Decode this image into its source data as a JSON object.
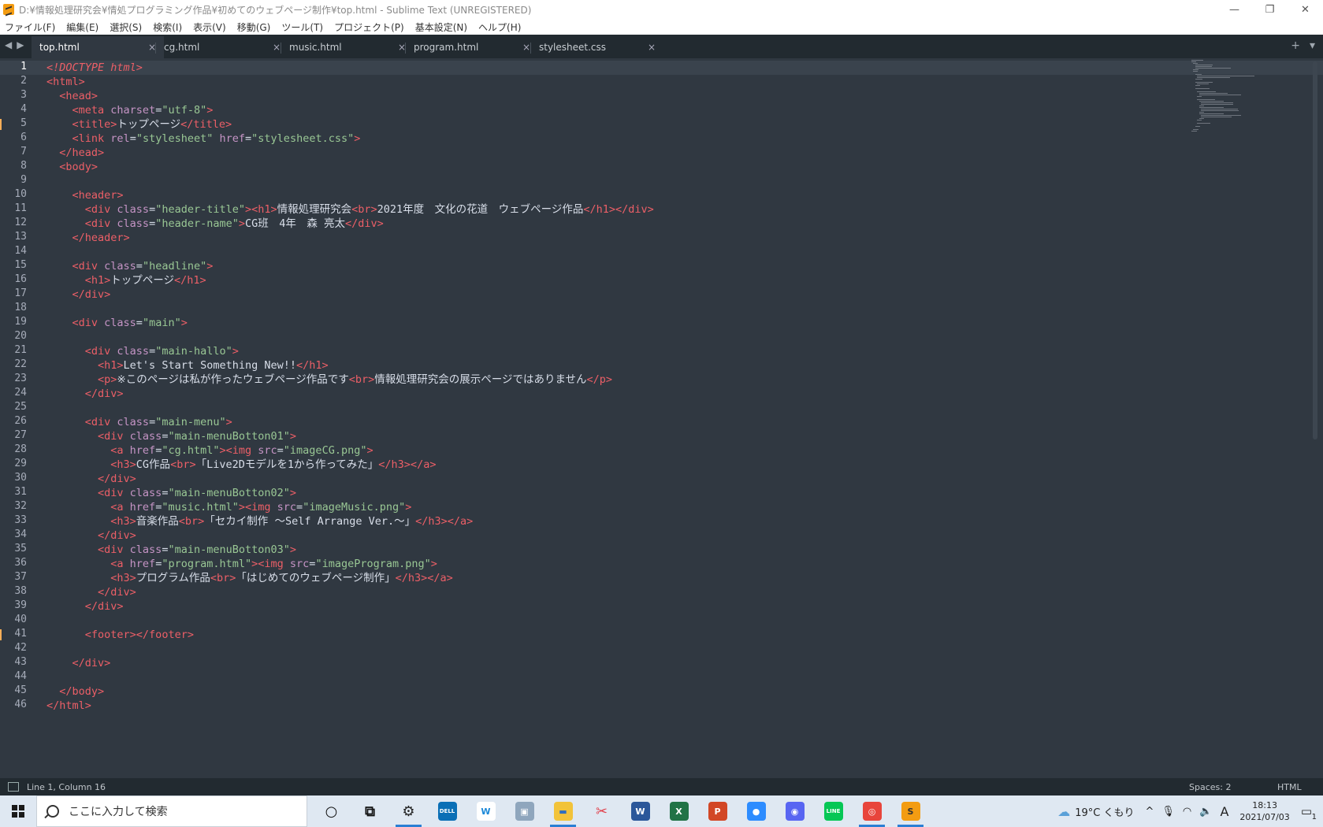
{
  "window": {
    "title": "D:¥情報処理研究会¥情処プログラミング作品¥初めてのウェブページ制作¥top.html - Sublime Text (UNREGISTERED)",
    "controls": {
      "minimize": "—",
      "restore": "❐",
      "close": "✕"
    }
  },
  "menu": {
    "items": [
      "ファイル(F)",
      "編集(E)",
      "選択(S)",
      "検索(I)",
      "表示(V)",
      "移動(G)",
      "ツール(T)",
      "プロジェクト(P)",
      "基本設定(N)",
      "ヘルプ(H)"
    ]
  },
  "tabs": [
    {
      "label": "top.html",
      "active": true
    },
    {
      "label": "cg.html",
      "active": false
    },
    {
      "label": "music.html",
      "active": false
    },
    {
      "label": "program.html",
      "active": false
    },
    {
      "label": "stylesheet.css",
      "active": false
    }
  ],
  "tab_close_glyph": "×",
  "tab_nav": {
    "back": "◀",
    "forward": "▶",
    "add": "+",
    "dropdown": "▾"
  },
  "editor": {
    "current_line": 1,
    "modified_lines": [
      5,
      41
    ],
    "lines": [
      [
        [
          "d",
          "<!DOCTYPE html"
        ],
        [
          "t",
          ">"
        ]
      ],
      [
        [
          "t",
          "<html>"
        ]
      ],
      [
        [
          "x",
          "  "
        ],
        [
          "t",
          "<head>"
        ]
      ],
      [
        [
          "x",
          "    "
        ],
        [
          "t",
          "<meta "
        ],
        [
          "a",
          "charset"
        ],
        [
          "x",
          "="
        ],
        [
          "s",
          "\"utf-8\""
        ],
        [
          "t",
          ">"
        ]
      ],
      [
        [
          "x",
          "    "
        ],
        [
          "t",
          "<title>"
        ],
        [
          "x",
          "トップページ"
        ],
        [
          "t",
          "</title>"
        ]
      ],
      [
        [
          "x",
          "    "
        ],
        [
          "t",
          "<link "
        ],
        [
          "a",
          "rel"
        ],
        [
          "x",
          "="
        ],
        [
          "s",
          "\"stylesheet\""
        ],
        [
          "x",
          " "
        ],
        [
          "a",
          "href"
        ],
        [
          "x",
          "="
        ],
        [
          "s",
          "\"stylesheet.css\""
        ],
        [
          "t",
          ">"
        ]
      ],
      [
        [
          "x",
          "  "
        ],
        [
          "t",
          "</head>"
        ]
      ],
      [
        [
          "x",
          "  "
        ],
        [
          "t",
          "<body>"
        ]
      ],
      [],
      [
        [
          "x",
          "    "
        ],
        [
          "t",
          "<header>"
        ]
      ],
      [
        [
          "x",
          "      "
        ],
        [
          "t",
          "<div "
        ],
        [
          "a",
          "class"
        ],
        [
          "x",
          "="
        ],
        [
          "s",
          "\"header-title\""
        ],
        [
          "t",
          "><h1>"
        ],
        [
          "x",
          "情報処理研究会"
        ],
        [
          "t",
          "<br>"
        ],
        [
          "x",
          "2021年度　文化の花道　ウェブページ作品"
        ],
        [
          "t",
          "</h1></div>"
        ]
      ],
      [
        [
          "x",
          "      "
        ],
        [
          "t",
          "<div "
        ],
        [
          "a",
          "class"
        ],
        [
          "x",
          "="
        ],
        [
          "s",
          "\"header-name\""
        ],
        [
          "t",
          ">"
        ],
        [
          "x",
          "CG班　4年　森 亮太"
        ],
        [
          "t",
          "</div>"
        ]
      ],
      [
        [
          "x",
          "    "
        ],
        [
          "t",
          "</header>"
        ]
      ],
      [],
      [
        [
          "x",
          "    "
        ],
        [
          "t",
          "<div "
        ],
        [
          "a",
          "class"
        ],
        [
          "x",
          "="
        ],
        [
          "s",
          "\"headline\""
        ],
        [
          "t",
          ">"
        ]
      ],
      [
        [
          "x",
          "      "
        ],
        [
          "t",
          "<h1>"
        ],
        [
          "x",
          "トップページ"
        ],
        [
          "t",
          "</h1>"
        ]
      ],
      [
        [
          "x",
          "    "
        ],
        [
          "t",
          "</div>"
        ]
      ],
      [],
      [
        [
          "x",
          "    "
        ],
        [
          "t",
          "<div "
        ],
        [
          "a",
          "class"
        ],
        [
          "x",
          "="
        ],
        [
          "s",
          "\"main\""
        ],
        [
          "t",
          ">"
        ]
      ],
      [],
      [
        [
          "x",
          "      "
        ],
        [
          "t",
          "<div "
        ],
        [
          "a",
          "class"
        ],
        [
          "x",
          "="
        ],
        [
          "s",
          "\"main-hallo\""
        ],
        [
          "t",
          ">"
        ]
      ],
      [
        [
          "x",
          "        "
        ],
        [
          "t",
          "<h1>"
        ],
        [
          "x",
          "Let's Start Something New!!"
        ],
        [
          "t",
          "</h1>"
        ]
      ],
      [
        [
          "x",
          "        "
        ],
        [
          "t",
          "<p>"
        ],
        [
          "x",
          "※このページは私が作ったウェブページ作品です"
        ],
        [
          "t",
          "<br>"
        ],
        [
          "x",
          "情報処理研究会の展示ページではありません"
        ],
        [
          "t",
          "</p>"
        ]
      ],
      [
        [
          "x",
          "      "
        ],
        [
          "t",
          "</div>"
        ]
      ],
      [],
      [
        [
          "x",
          "      "
        ],
        [
          "t",
          "<div "
        ],
        [
          "a",
          "class"
        ],
        [
          "x",
          "="
        ],
        [
          "s",
          "\"main-menu\""
        ],
        [
          "t",
          ">"
        ]
      ],
      [
        [
          "x",
          "        "
        ],
        [
          "t",
          "<div "
        ],
        [
          "a",
          "class"
        ],
        [
          "x",
          "="
        ],
        [
          "s",
          "\"main-menuBotton01\""
        ],
        [
          "t",
          ">"
        ]
      ],
      [
        [
          "x",
          "          "
        ],
        [
          "t",
          "<a "
        ],
        [
          "a",
          "href"
        ],
        [
          "x",
          "="
        ],
        [
          "s",
          "\"cg.html\""
        ],
        [
          "t",
          "><img "
        ],
        [
          "a",
          "src"
        ],
        [
          "x",
          "="
        ],
        [
          "s",
          "\"imageCG.png\""
        ],
        [
          "t",
          ">"
        ]
      ],
      [
        [
          "x",
          "          "
        ],
        [
          "t",
          "<h3>"
        ],
        [
          "x",
          "CG作品"
        ],
        [
          "t",
          "<br>"
        ],
        [
          "x",
          "「Live2Dモデルを1から作ってみた」"
        ],
        [
          "t",
          "</h3></a>"
        ]
      ],
      [
        [
          "x",
          "        "
        ],
        [
          "t",
          "</div>"
        ]
      ],
      [
        [
          "x",
          "        "
        ],
        [
          "t",
          "<div "
        ],
        [
          "a",
          "class"
        ],
        [
          "x",
          "="
        ],
        [
          "s",
          "\"main-menuBotton02\""
        ],
        [
          "t",
          ">"
        ]
      ],
      [
        [
          "x",
          "          "
        ],
        [
          "t",
          "<a "
        ],
        [
          "a",
          "href"
        ],
        [
          "x",
          "="
        ],
        [
          "s",
          "\"music.html\""
        ],
        [
          "t",
          "><img "
        ],
        [
          "a",
          "src"
        ],
        [
          "x",
          "="
        ],
        [
          "s",
          "\"imageMusic.png\""
        ],
        [
          "t",
          ">"
        ]
      ],
      [
        [
          "x",
          "          "
        ],
        [
          "t",
          "<h3>"
        ],
        [
          "x",
          "音楽作品"
        ],
        [
          "t",
          "<br>"
        ],
        [
          "x",
          "「セカイ制作 ～Self Arrange Ver.～」"
        ],
        [
          "t",
          "</h3></a>"
        ]
      ],
      [
        [
          "x",
          "        "
        ],
        [
          "t",
          "</div>"
        ]
      ],
      [
        [
          "x",
          "        "
        ],
        [
          "t",
          "<div "
        ],
        [
          "a",
          "class"
        ],
        [
          "x",
          "="
        ],
        [
          "s",
          "\"main-menuBotton03\""
        ],
        [
          "t",
          ">"
        ]
      ],
      [
        [
          "x",
          "          "
        ],
        [
          "t",
          "<a "
        ],
        [
          "a",
          "href"
        ],
        [
          "x",
          "="
        ],
        [
          "s",
          "\"program.html\""
        ],
        [
          "t",
          "><img "
        ],
        [
          "a",
          "src"
        ],
        [
          "x",
          "="
        ],
        [
          "s",
          "\"imageProgram.png\""
        ],
        [
          "t",
          ">"
        ]
      ],
      [
        [
          "x",
          "          "
        ],
        [
          "t",
          "<h3>"
        ],
        [
          "x",
          "プログラム作品"
        ],
        [
          "t",
          "<br>"
        ],
        [
          "x",
          "「はじめてのウェブページ制作」"
        ],
        [
          "t",
          "</h3></a>"
        ]
      ],
      [
        [
          "x",
          "        "
        ],
        [
          "t",
          "</div>"
        ]
      ],
      [
        [
          "x",
          "      "
        ],
        [
          "t",
          "</div>"
        ]
      ],
      [],
      [
        [
          "x",
          "      "
        ],
        [
          "t",
          "<footer></footer>"
        ]
      ],
      [],
      [
        [
          "x",
          "    "
        ],
        [
          "t",
          "</div>"
        ]
      ],
      [],
      [
        [
          "x",
          "  "
        ],
        [
          "t",
          "</body>"
        ]
      ],
      [
        [
          "t",
          "</html>"
        ]
      ]
    ]
  },
  "status": {
    "position": "Line 1, Column 16",
    "indent": "Spaces: 2",
    "syntax": "HTML"
  },
  "taskbar": {
    "search_placeholder": "ここに入力して検索",
    "apps": [
      {
        "name": "cortana-icon",
        "glyph": "○",
        "color": "transparent",
        "text_color": "#111",
        "open": false
      },
      {
        "name": "task-view-icon",
        "glyph": "⧉",
        "color": "transparent",
        "text_color": "#111",
        "open": false
      },
      {
        "name": "settings-icon",
        "glyph": "⚙",
        "color": "transparent",
        "text_color": "#222",
        "open": true
      },
      {
        "name": "dell-icon",
        "glyph": "DELL",
        "color": "#0a6fb6",
        "text_color": "#fff",
        "open": false
      },
      {
        "name": "wps-icon",
        "glyph": "W",
        "color": "#ffffff",
        "text_color": "#1a88d8",
        "open": false
      },
      {
        "name": "photos-icon",
        "glyph": "▣",
        "color": "#8fa6bd",
        "text_color": "#fff",
        "open": false
      },
      {
        "name": "file-explorer-icon",
        "glyph": "▬",
        "color": "#f2c33a",
        "text_color": "#2f6fbf",
        "open": true
      },
      {
        "name": "snip-icon",
        "glyph": "✂",
        "color": "transparent",
        "text_color": "#e0434e",
        "open": false
      },
      {
        "name": "word-icon",
        "glyph": "W",
        "color": "#2b579a",
        "text_color": "#fff",
        "open": false
      },
      {
        "name": "excel-icon",
        "glyph": "X",
        "color": "#217346",
        "text_color": "#fff",
        "open": false
      },
      {
        "name": "powerpoint-icon",
        "glyph": "P",
        "color": "#d24726",
        "text_color": "#fff",
        "open": false
      },
      {
        "name": "zoom-icon",
        "glyph": "●",
        "color": "#2d8cff",
        "text_color": "#fff",
        "open": false
      },
      {
        "name": "discord-icon",
        "glyph": "◉",
        "color": "#5865f2",
        "text_color": "#fff",
        "open": false
      },
      {
        "name": "line-icon",
        "glyph": "LINE",
        "color": "#06c755",
        "text_color": "#fff",
        "open": false
      },
      {
        "name": "chrome-icon",
        "glyph": "◎",
        "color": "#e8453c",
        "text_color": "#fff",
        "open": true
      },
      {
        "name": "sublime-icon",
        "glyph": "S",
        "color": "#f39c12",
        "text_color": "#333",
        "open": true
      }
    ],
    "weather": "19°C くもり",
    "tray_up": "^",
    "ime": "A",
    "time": "18:13",
    "date": "2021/07/03",
    "notifications": "1"
  },
  "colors": {
    "editor_bg": "#303841",
    "tag": "#ec5f67",
    "attr": "#c594c5",
    "string": "#99c794",
    "text": "#d8dee9"
  }
}
